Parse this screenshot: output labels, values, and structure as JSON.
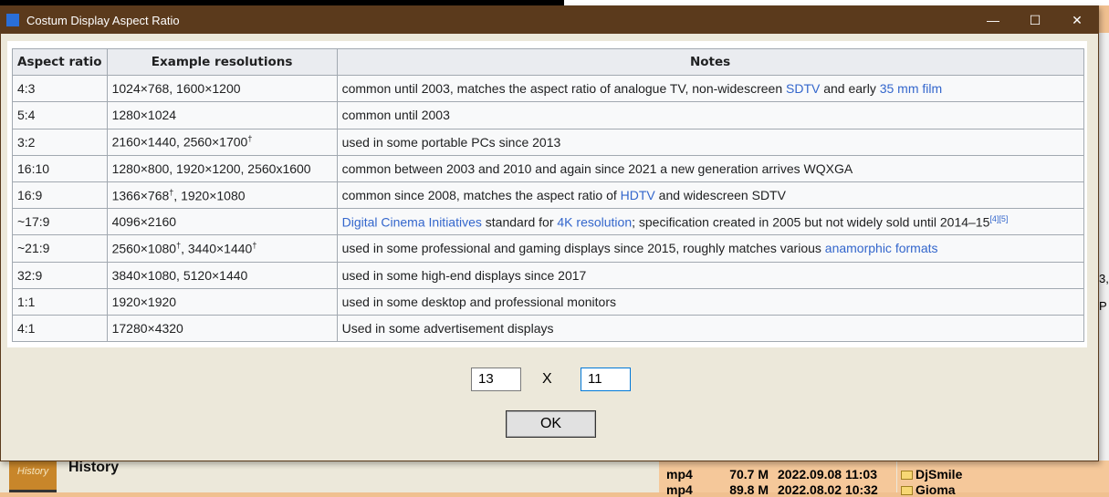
{
  "window": {
    "title": "Costum Display Aspect Ratio",
    "minimize": "—",
    "maximize": "☐",
    "close": "✕"
  },
  "table": {
    "headers": [
      "Aspect ratio",
      "Example resolutions",
      "Notes"
    ],
    "rows": [
      {
        "ratio": "4:3",
        "res": [
          {
            "t": "1024×768, 1600×1200"
          }
        ],
        "notes": [
          {
            "t": "common until 2003, matches the aspect ratio of analogue TV, non-widescreen "
          },
          {
            "t": "SDTV",
            "link": true
          },
          {
            "t": " and early "
          },
          {
            "t": "35 mm film",
            "link": true
          }
        ]
      },
      {
        "ratio": "5:4",
        "res": [
          {
            "t": "1280×1024"
          }
        ],
        "notes": [
          {
            "t": "common until 2003"
          }
        ]
      },
      {
        "ratio": "3:2",
        "res": [
          {
            "t": "2160×1440, 2560×1700"
          },
          {
            "t": "†",
            "sup": true
          }
        ],
        "notes": [
          {
            "t": "used in some portable PCs since 2013"
          }
        ]
      },
      {
        "ratio": "16:10",
        "res": [
          {
            "t": "1280×800, 1920×1200, 2560x1600"
          }
        ],
        "notes": [
          {
            "t": "common between 2003 and 2010 and again since 2021 a new generation arrives WQXGA"
          }
        ]
      },
      {
        "ratio": "16:9",
        "res": [
          {
            "t": "1366×768"
          },
          {
            "t": "†",
            "sup": true
          },
          {
            "t": ", 1920×1080"
          }
        ],
        "notes": [
          {
            "t": "common since 2008, matches the aspect ratio of "
          },
          {
            "t": "HDTV",
            "link": true
          },
          {
            "t": " and widescreen SDTV"
          }
        ]
      },
      {
        "ratio": "~17:9",
        "res": [
          {
            "t": "4096×2160"
          }
        ],
        "notes": [
          {
            "t": "Digital Cinema Initiatives",
            "link": true
          },
          {
            "t": " standard for "
          },
          {
            "t": "4K resolution",
            "link": true
          },
          {
            "t": "; specification created in 2005 but not widely sold until 2014–15"
          },
          {
            "t": "[4][5]",
            "sup": true,
            "link": true
          }
        ]
      },
      {
        "ratio": "~21:9",
        "res": [
          {
            "t": "2560×1080"
          },
          {
            "t": "†",
            "sup": true
          },
          {
            "t": ", 3440×1440"
          },
          {
            "t": "†",
            "sup": true
          }
        ],
        "notes": [
          {
            "t": "used in some professional and gaming displays since 2015, roughly matches various "
          },
          {
            "t": "anamorphic formats",
            "link": true
          }
        ]
      },
      {
        "ratio": "32:9",
        "res": [
          {
            "t": "3840×1080, 5120×1440"
          }
        ],
        "notes": [
          {
            "t": "used in some high-end displays since 2017"
          }
        ]
      },
      {
        "ratio": "1:1",
        "res": [
          {
            "t": "1920×1920"
          }
        ],
        "notes": [
          {
            "t": "used in some desktop and professional monitors"
          }
        ]
      },
      {
        "ratio": "4:1",
        "res": [
          {
            "t": "17280×4320"
          }
        ],
        "notes": [
          {
            "t": "Used in some advertisement displays"
          }
        ]
      }
    ]
  },
  "form": {
    "width": "13",
    "separator": "X",
    "height": "11",
    "ok": "OK"
  },
  "background": {
    "history": "History",
    "history_icon": "History",
    "right_fragments": [
      "3,",
      "P"
    ],
    "files": [
      {
        "type": "mp4",
        "size": "70.7 M",
        "date": "2022.09.08 11:03"
      },
      {
        "type": "mp4",
        "size": "89.8 M",
        "date": "2022.08.02 10:32"
      }
    ],
    "folders": [
      "DjSmile",
      "Gioma"
    ]
  }
}
